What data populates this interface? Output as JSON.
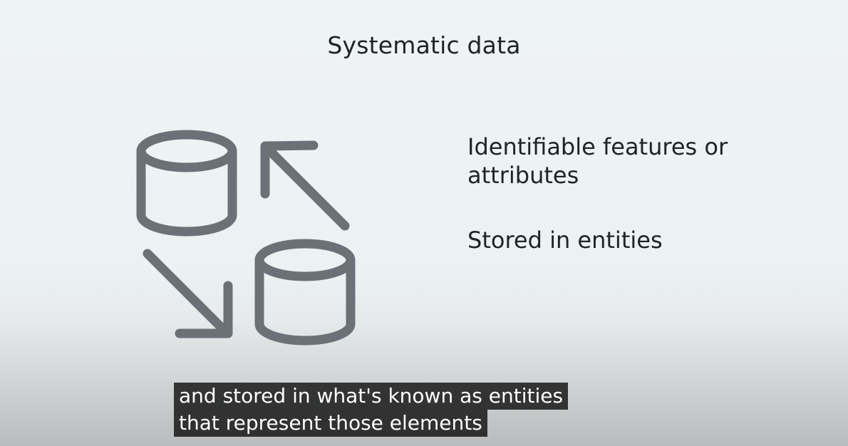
{
  "slide": {
    "title": "Systematic data",
    "bullets": [
      "Identifiable features or\nattributes",
      "Stored in entities"
    ],
    "icons": [
      "database-icon",
      "arrow-up-left-icon",
      "arrow-down-right-icon",
      "database-icon"
    ],
    "colors": {
      "background": "#eef3f5",
      "icon_stroke": "#6b7177",
      "text": "#1f2326",
      "caption_bg": "#141414"
    }
  },
  "captions": {
    "line1": "and stored in what's known as entities",
    "line2": "that represent those elements"
  }
}
